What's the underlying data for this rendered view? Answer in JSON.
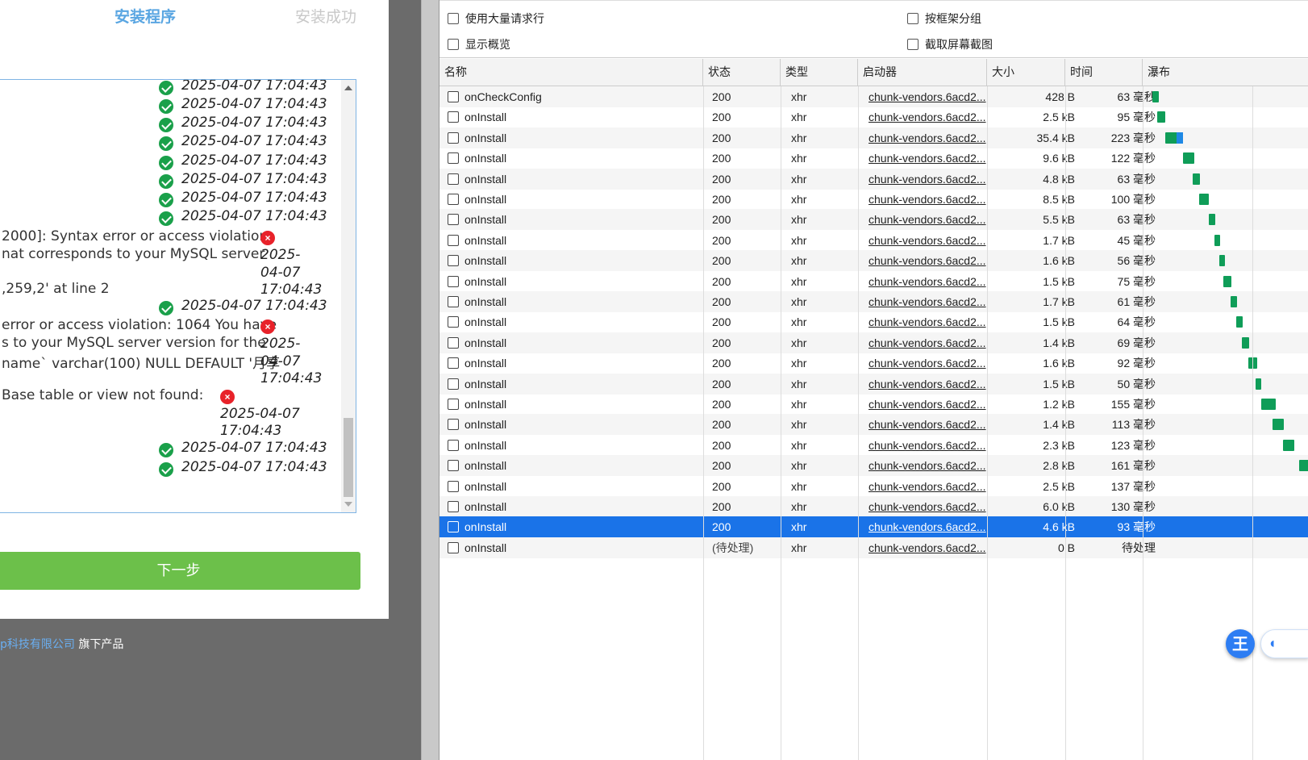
{
  "installer": {
    "steps": {
      "install": "安装程序",
      "success": "安装成功"
    },
    "log": {
      "timestamp": "2025-04-07 17:04:43",
      "ts_part1": "2025-",
      "ts_part2": "04-07",
      "ts_part3": "17:04:43",
      "ts_date": "2025-04-07",
      "error1": [
        "2000]: Syntax error or access violation:",
        "nat corresponds to your MySQL server",
        ",259,2' at line 2"
      ],
      "error2": [
        "error or access violation: 1064 You have",
        "s to your MySQL server version for the",
        "name` varchar(100) NULL DEFAULT '月享"
      ],
      "error3": [
        "Base table or view not found:"
      ]
    },
    "next_button": "下一步",
    "footer": {
      "company": "p科技有限公司",
      "suffix": " 旗下产品"
    }
  },
  "devtools": {
    "options": {
      "large_rows": "使用大量请求行",
      "group_by_frame": "按框架分组",
      "overview": "显示概览",
      "screenshots": "截取屏幕截图"
    },
    "columns": {
      "name": "名称",
      "status": "状态",
      "type": "类型",
      "initiator": "启动器",
      "size": "大小",
      "time": "时间",
      "waterfall": "瀑布"
    },
    "rows": [
      {
        "name": "onCheckConfig",
        "status": "200",
        "type": "xhr",
        "initiator": "chunk-vendors.6acd2...",
        "size": "428 B",
        "time": "63 毫秒"
      },
      {
        "name": "onInstall",
        "status": "200",
        "type": "xhr",
        "initiator": "chunk-vendors.6acd2...",
        "size": "2.5 kB",
        "time": "95 毫秒"
      },
      {
        "name": "onInstall",
        "status": "200",
        "type": "xhr",
        "initiator": "chunk-vendors.6acd2...",
        "size": "35.4 kB",
        "time": "223 毫秒"
      },
      {
        "name": "onInstall",
        "status": "200",
        "type": "xhr",
        "initiator": "chunk-vendors.6acd2...",
        "size": "9.6 kB",
        "time": "122 毫秒"
      },
      {
        "name": "onInstall",
        "status": "200",
        "type": "xhr",
        "initiator": "chunk-vendors.6acd2...",
        "size": "4.8 kB",
        "time": "63 毫秒"
      },
      {
        "name": "onInstall",
        "status": "200",
        "type": "xhr",
        "initiator": "chunk-vendors.6acd2...",
        "size": "8.5 kB",
        "time": "100 毫秒"
      },
      {
        "name": "onInstall",
        "status": "200",
        "type": "xhr",
        "initiator": "chunk-vendors.6acd2...",
        "size": "5.5 kB",
        "time": "63 毫秒"
      },
      {
        "name": "onInstall",
        "status": "200",
        "type": "xhr",
        "initiator": "chunk-vendors.6acd2...",
        "size": "1.7 kB",
        "time": "45 毫秒"
      },
      {
        "name": "onInstall",
        "status": "200",
        "type": "xhr",
        "initiator": "chunk-vendors.6acd2...",
        "size": "1.6 kB",
        "time": "56 毫秒"
      },
      {
        "name": "onInstall",
        "status": "200",
        "type": "xhr",
        "initiator": "chunk-vendors.6acd2...",
        "size": "1.5 kB",
        "time": "75 毫秒"
      },
      {
        "name": "onInstall",
        "status": "200",
        "type": "xhr",
        "initiator": "chunk-vendors.6acd2...",
        "size": "1.7 kB",
        "time": "61 毫秒"
      },
      {
        "name": "onInstall",
        "status": "200",
        "type": "xhr",
        "initiator": "chunk-vendors.6acd2...",
        "size": "1.5 kB",
        "time": "64 毫秒"
      },
      {
        "name": "onInstall",
        "status": "200",
        "type": "xhr",
        "initiator": "chunk-vendors.6acd2...",
        "size": "1.4 kB",
        "time": "69 毫秒"
      },
      {
        "name": "onInstall",
        "status": "200",
        "type": "xhr",
        "initiator": "chunk-vendors.6acd2...",
        "size": "1.6 kB",
        "time": "92 毫秒"
      },
      {
        "name": "onInstall",
        "status": "200",
        "type": "xhr",
        "initiator": "chunk-vendors.6acd2...",
        "size": "1.5 kB",
        "time": "50 毫秒"
      },
      {
        "name": "onInstall",
        "status": "200",
        "type": "xhr",
        "initiator": "chunk-vendors.6acd2...",
        "size": "1.2 kB",
        "time": "155 毫秒"
      },
      {
        "name": "onInstall",
        "status": "200",
        "type": "xhr",
        "initiator": "chunk-vendors.6acd2...",
        "size": "1.4 kB",
        "time": "113 毫秒"
      },
      {
        "name": "onInstall",
        "status": "200",
        "type": "xhr",
        "initiator": "chunk-vendors.6acd2...",
        "size": "2.3 kB",
        "time": "123 毫秒"
      },
      {
        "name": "onInstall",
        "status": "200",
        "type": "xhr",
        "initiator": "chunk-vendors.6acd2...",
        "size": "2.8 kB",
        "time": "161 毫秒"
      },
      {
        "name": "onInstall",
        "status": "200",
        "type": "xhr",
        "initiator": "chunk-vendors.6acd2...",
        "size": "2.5 kB",
        "time": "137 毫秒"
      },
      {
        "name": "onInstall",
        "status": "200",
        "type": "xhr",
        "initiator": "chunk-vendors.6acd2...",
        "size": "6.0 kB",
        "time": "130 毫秒"
      },
      {
        "name": "onInstall",
        "status": "200",
        "type": "xhr",
        "initiator": "chunk-vendors.6acd2...",
        "size": "4.6 kB",
        "time": "93 毫秒",
        "selected": true
      },
      {
        "name": "onInstall",
        "status": "(待处理)",
        "type": "xhr",
        "initiator": "chunk-vendors.6acd2...",
        "size": "0 B",
        "time": "待处理",
        "pending": true
      }
    ],
    "floating_badge": "王",
    "colors": {
      "selected": "#1a73e8",
      "bar_receive": "#0f9d58",
      "bar_wait": "#1e88e5",
      "next_button": "#6cc04a",
      "ok": "#1aa04a",
      "error": "#e8222a"
    }
  }
}
